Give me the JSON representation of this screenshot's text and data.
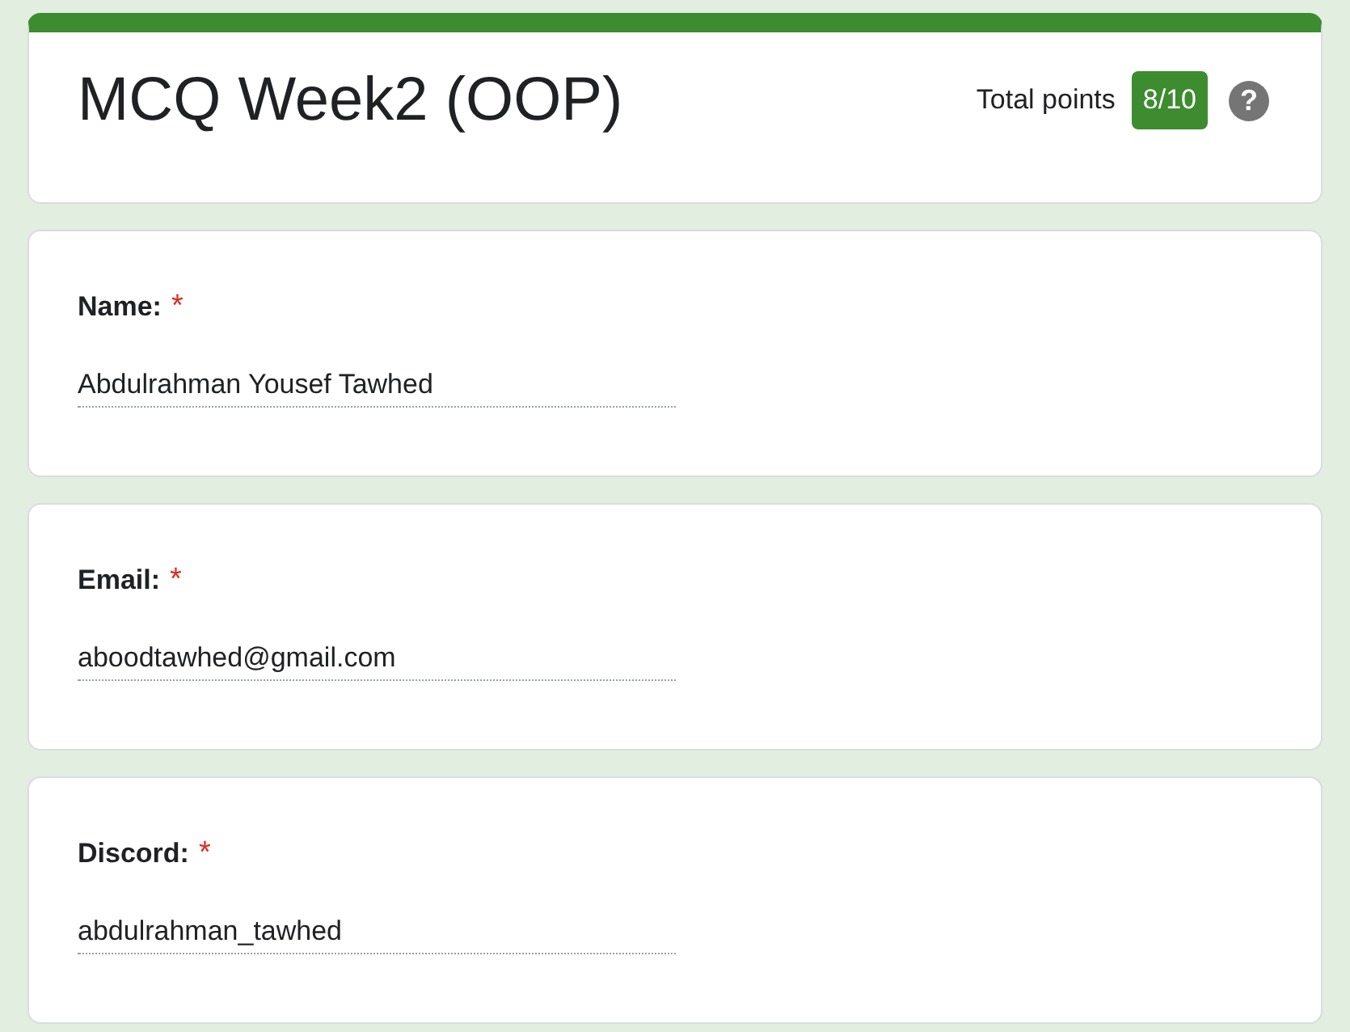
{
  "header": {
    "title": "MCQ Week2 (OOP)",
    "total_points_label": "Total points",
    "score": "8/10",
    "help": "?"
  },
  "fields": [
    {
      "label": "Name:",
      "required_mark": "*",
      "value": "Abdulrahman Yousef Tawhed"
    },
    {
      "label": "Email:",
      "required_mark": "*",
      "value": "aboodtawhed@gmail.com"
    },
    {
      "label": "Discord:",
      "required_mark": "*",
      "value": "abdulrahman_tawhed"
    }
  ]
}
